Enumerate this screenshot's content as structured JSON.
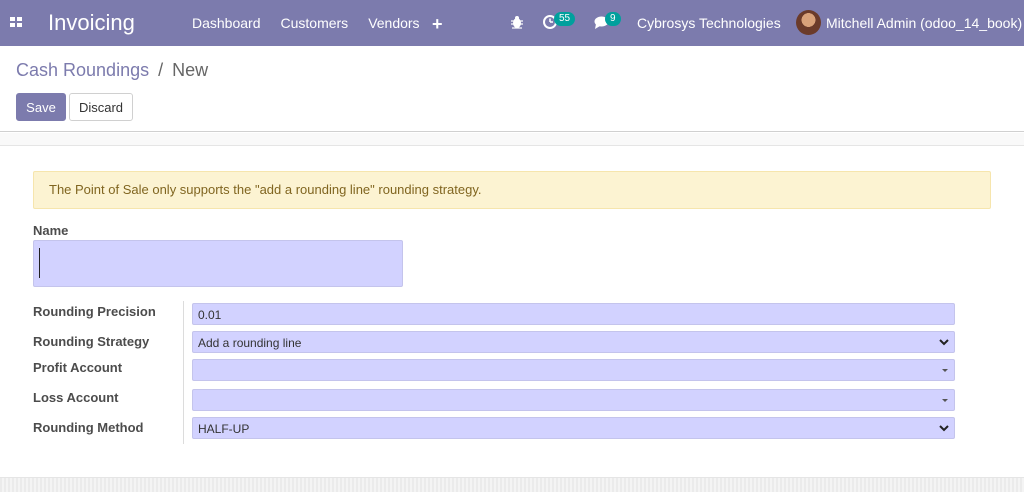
{
  "navbar": {
    "app_title": "Invoicing",
    "menu": [
      "Dashboard",
      "Customers",
      "Vendors"
    ],
    "plus_label": "+",
    "activity_count": "55",
    "message_count": "9",
    "company": "Cybrosys Technologies",
    "user": "Mitchell Admin (odoo_14_book)",
    "icons": [
      "apps-grid-icon",
      "bug-icon",
      "activity-clock-icon",
      "chat-icon"
    ]
  },
  "breadcrumb": {
    "parent": "Cash Roundings",
    "separator": "/",
    "current": "New"
  },
  "buttons": {
    "save": "Save",
    "discard": "Discard"
  },
  "alert": "The Point of Sale only supports the \"add a rounding line\" rounding strategy.",
  "form": {
    "name_label": "Name",
    "name_value": "",
    "precision_label": "Rounding Precision",
    "precision_value": "0.01",
    "strategy_label": "Rounding Strategy",
    "strategy_value": "Add a rounding line",
    "profit_label": "Profit Account",
    "profit_value": "",
    "loss_label": "Loss Account",
    "loss_value": "",
    "method_label": "Rounding Method",
    "method_value": "HALF-UP"
  },
  "colors": {
    "navbar": "#7c7bad",
    "badge": "#00a09d",
    "field": "#d2d2ff",
    "alert_bg": "#fcf3d2"
  }
}
